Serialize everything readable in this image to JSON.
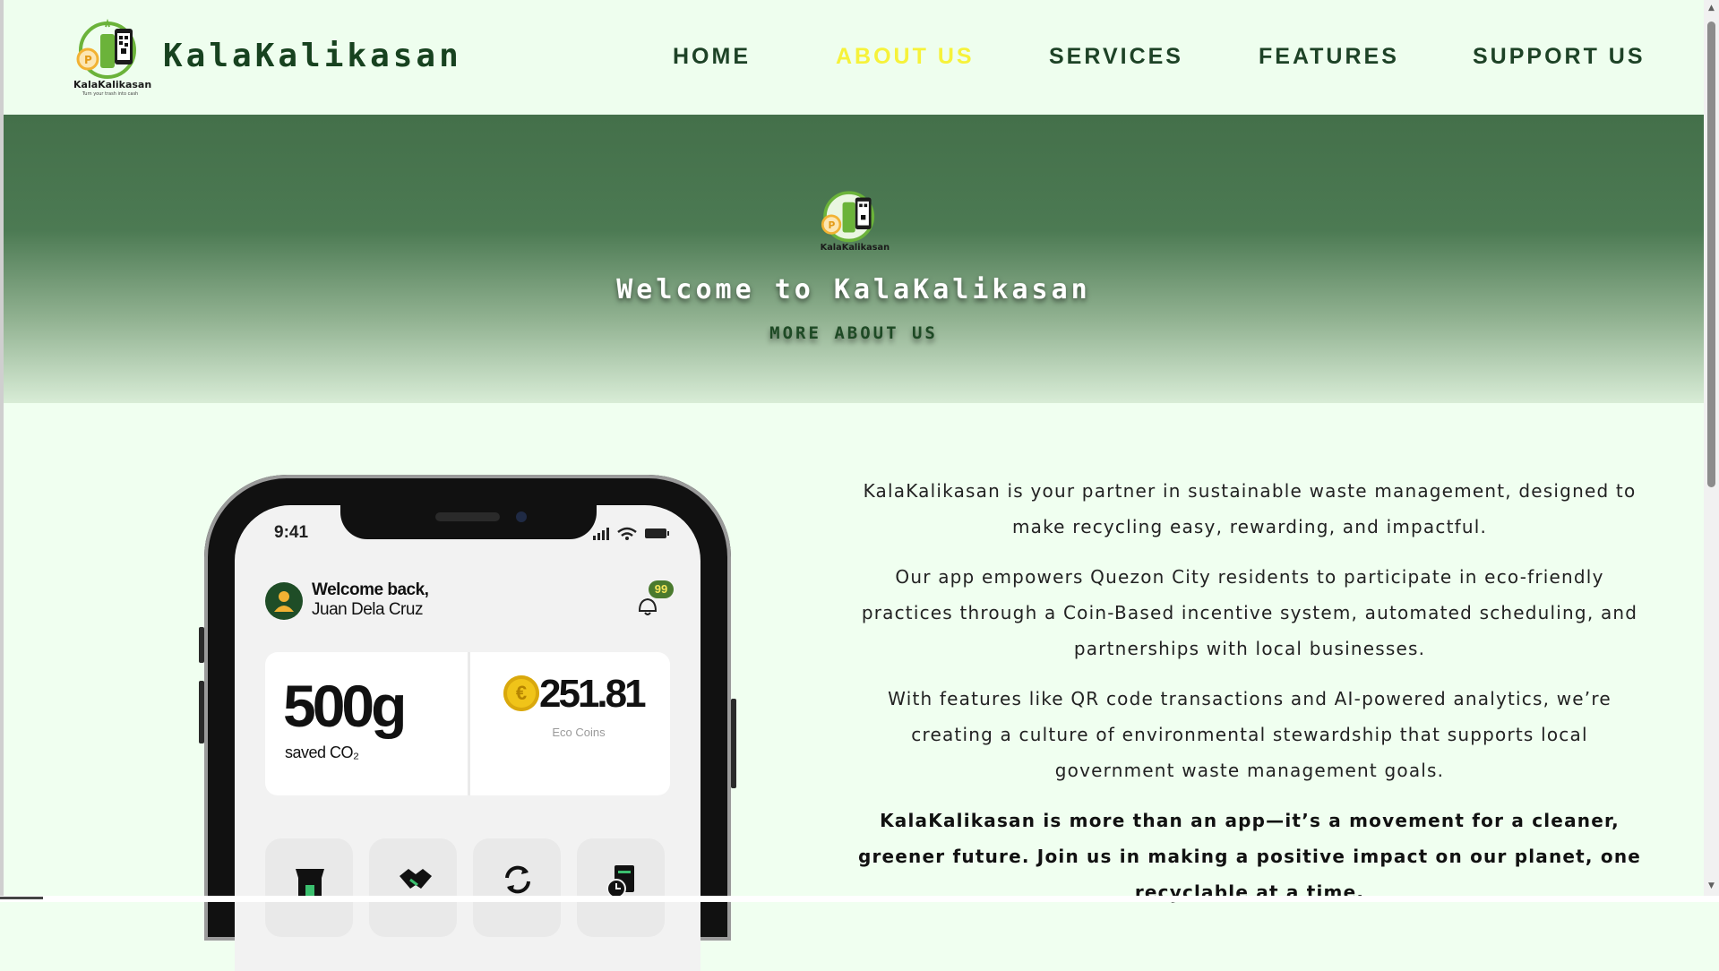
{
  "header": {
    "logo_text": "KalaKalikasan",
    "logo_tagline": "Turn your trash into cash",
    "brand": "KalaKalikasan",
    "nav": [
      {
        "label": "HOME",
        "active": false
      },
      {
        "label": "ABOUT US",
        "active": true
      },
      {
        "label": "SERVICES",
        "active": false
      },
      {
        "label": "FEATURES",
        "active": false
      },
      {
        "label": "SUPPORT US",
        "active": false
      }
    ]
  },
  "hero": {
    "logo_text": "KalaKalikasan",
    "title": "Welcome to KalaKalikasan",
    "subtitle": "MORE ABOUT US"
  },
  "phone": {
    "time": "9:41",
    "welcome_line1": "Welcome back,",
    "welcome_line2": "Juan Dela Cruz",
    "notification_count": "99",
    "co2_value": "500g",
    "co2_label": "saved CO₂",
    "coins_value": "251.81",
    "coins_label": "Eco Coins",
    "quick_icons": [
      "store-icon",
      "handshake-icon",
      "recycle-icon",
      "history-icon"
    ]
  },
  "about": {
    "paragraphs": [
      "KalaKalikasan is your partner in sustainable waste management, designed to make recycling easy, rewarding, and impactful.",
      "Our app empowers Quezon City residents to participate in eco-friendly practices through a Coin-Based incentive system, automated scheduling, and partnerships with local businesses.",
      "With features like QR code transactions and AI-powered analytics, we’re creating a culture of environmental stewardship that supports local government waste management goals."
    ],
    "closing": "KalaKalikasan is more than an app—it’s a movement for a cleaner, greener future. Join us in making a positive impact on our planet, one recyclable at a time."
  },
  "colors": {
    "background": "#f0fff0",
    "brand_green": "#17421f",
    "hero_green": "#44704a",
    "nav_active": "#f6f23a"
  }
}
